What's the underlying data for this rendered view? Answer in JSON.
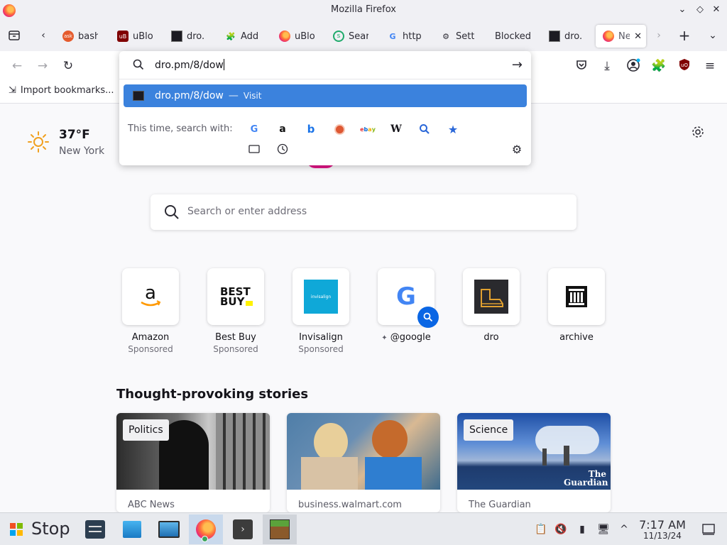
{
  "window": {
    "title": "Mozilla Firefox"
  },
  "tabs": [
    {
      "label": "bash",
      "favicon": "ask-icon"
    },
    {
      "label": "uBlo",
      "favicon": "ublock-icon"
    },
    {
      "label": "dro.",
      "favicon": "dro-icon"
    },
    {
      "label": "Add",
      "favicon": "addon-icon"
    },
    {
      "label": "uBlo",
      "favicon": "firefox-icon"
    },
    {
      "label": "Sear",
      "favicon": "search-green-icon"
    },
    {
      "label": "http",
      "favicon": "google-icon"
    },
    {
      "label": "Sett",
      "favicon": "gear-icon"
    },
    {
      "label": "Blocked",
      "favicon": ""
    },
    {
      "label": "dro.",
      "favicon": "dro-icon"
    },
    {
      "label": "Ne",
      "favicon": "firefox-icon",
      "active": true
    }
  ],
  "bookmarks": {
    "import_label": "Import bookmarks..."
  },
  "urlbar": {
    "value": "dro.pm/8/dow",
    "result_text": "dro.pm/8/dow",
    "result_sep": "—",
    "result_action": "Visit",
    "search_with_label": "This time, search with:",
    "engines": [
      "Google",
      "Amazon",
      "Bing",
      "DuckDuckGo",
      "eBay",
      "Wikipedia",
      "Search",
      "Bookmarks"
    ]
  },
  "weather": {
    "temp": "37°F",
    "city": "New York"
  },
  "search": {
    "placeholder": "Search or enter address"
  },
  "shortcuts": [
    {
      "name": "Amazon",
      "sponsored": "Sponsored"
    },
    {
      "name": "Best Buy",
      "sponsored": "Sponsored",
      "logo_text": "BEST BUY"
    },
    {
      "name": "Invisalign",
      "sponsored": "Sponsored",
      "logo_text": "invisalign"
    },
    {
      "name": "@google",
      "sponsored": ""
    },
    {
      "name": "dro",
      "sponsored": ""
    },
    {
      "name": "archive",
      "sponsored": ""
    }
  ],
  "stories": {
    "heading": "Thought-provoking stories",
    "cards": [
      {
        "tag": "Politics",
        "source": "ABC News"
      },
      {
        "tag": "",
        "source": "business.walmart.com"
      },
      {
        "tag": "Science",
        "source": "The Guardian",
        "overlay": "The Guardian"
      }
    ]
  },
  "taskbar": {
    "stop_label": "Stop",
    "time": "7:17 AM",
    "date": "11/13/24"
  }
}
